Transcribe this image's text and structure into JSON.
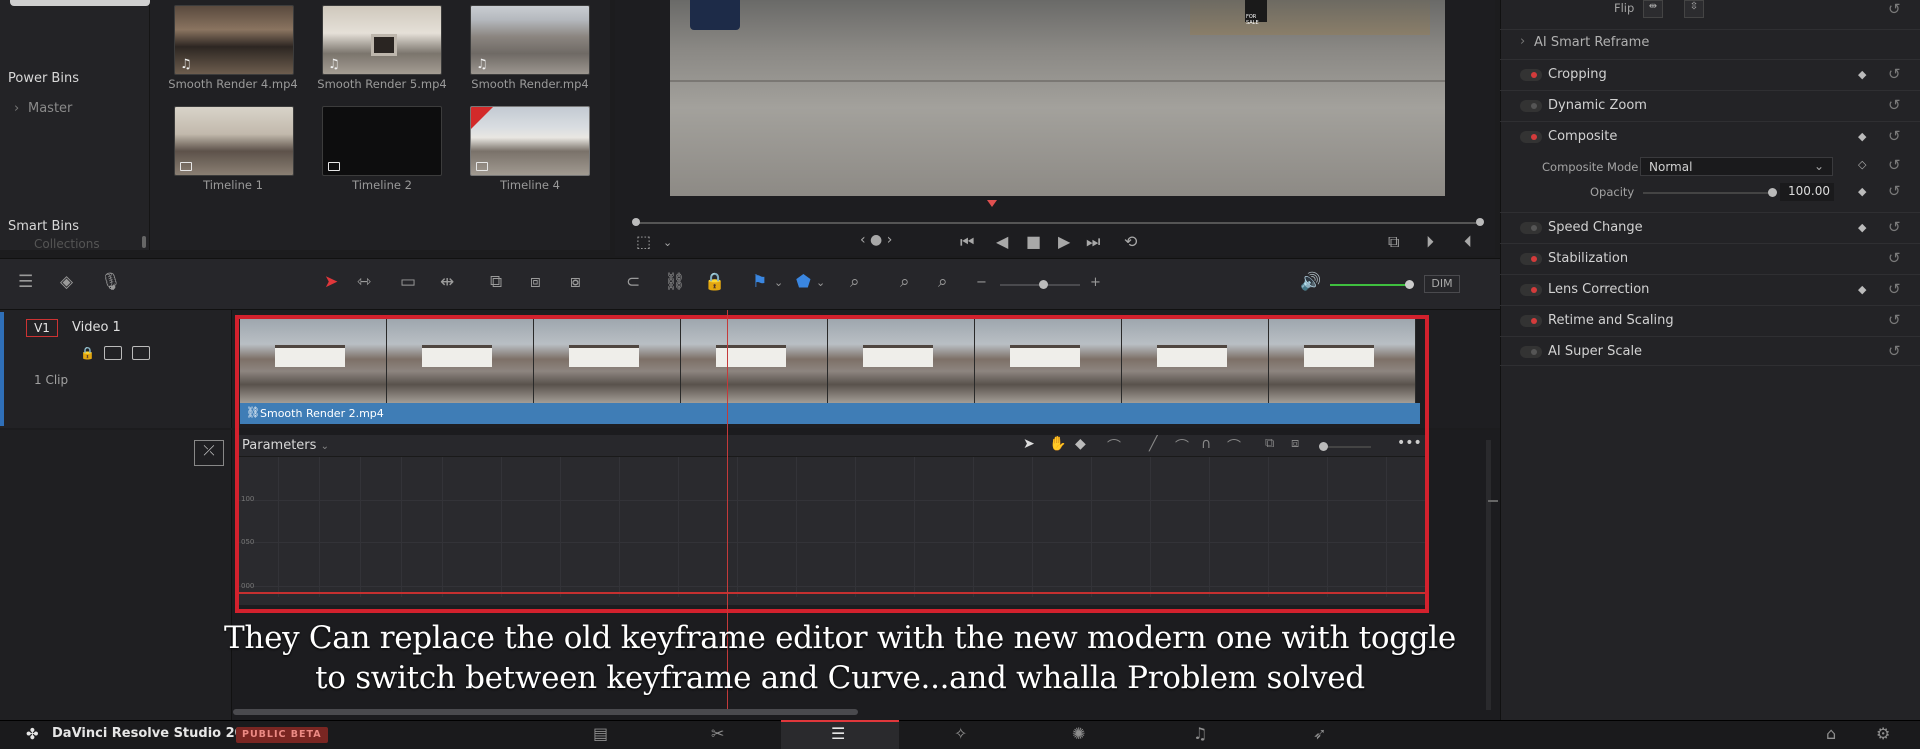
{
  "bins": {
    "power_bins": "Power Bins",
    "master": "Master",
    "smart_bins": "Smart Bins",
    "collections": "Collections"
  },
  "media_pool": {
    "clips": [
      {
        "name": "Smooth Render 4.mp4"
      },
      {
        "name": "Smooth Render 5.mp4"
      },
      {
        "name": "Smooth Render.mp4"
      },
      {
        "name": "Timeline 1"
      },
      {
        "name": "Timeline 2"
      },
      {
        "name": "Timeline 4"
      }
    ]
  },
  "viewer": {
    "sign_text": "FOR SALE"
  },
  "inspector": {
    "flip_label": "Flip",
    "ai_smart_reframe": "AI Smart Reframe",
    "sections": [
      {
        "label": "Cropping",
        "enabled": true
      },
      {
        "label": "Dynamic Zoom",
        "enabled": false
      },
      {
        "label": "Composite",
        "enabled": true
      },
      {
        "label": "Speed Change",
        "enabled": false
      },
      {
        "label": "Stabilization",
        "enabled": true
      },
      {
        "label": "Lens Correction",
        "enabled": true
      },
      {
        "label": "Retime and Scaling",
        "enabled": true
      },
      {
        "label": "AI Super Scale",
        "enabled": false
      }
    ],
    "composite_mode_label": "Composite Mode",
    "composite_mode_value": "Normal",
    "opacity_label": "Opacity",
    "opacity_value": "100.00"
  },
  "toolbar": {
    "dim_label": "DIM"
  },
  "track": {
    "id": "V1",
    "name": "Video 1",
    "clip_count": "1 Clip",
    "clip_name": "Smooth Render 2.mp4"
  },
  "params": {
    "title": "Parameters",
    "axis": [
      "100",
      "050",
      "000"
    ]
  },
  "caption": {
    "line1": "They Can replace the old keyframe editor with the new modern one with toggle",
    "line2": "to switch between keyframe and Curve...and whalla Problem solved"
  },
  "app": {
    "name": "DaVinci Resolve Studio 20",
    "badge": "PUBLIC BETA"
  },
  "colors": {
    "accent_red": "#d3212d",
    "clip_blue": "#3f7db6",
    "volume_green": "#3fbf3f"
  }
}
